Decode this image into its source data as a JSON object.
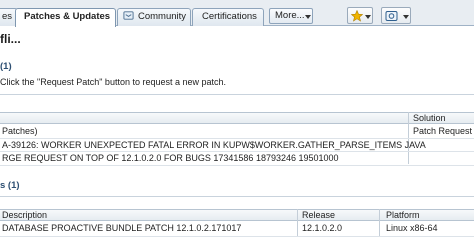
{
  "tabs": {
    "partial_prev_label": "es",
    "active_label": "Patches & Updates",
    "community_label": "Community",
    "certifications_label": "Certifications",
    "more_label": "More..."
  },
  "page": {
    "title": "fli..."
  },
  "requests_section": {
    "heading": "(1)",
    "instruction": "Click the \"Request Patch\" button to request a new patch.",
    "columns": [
      "",
      "Solution"
    ],
    "rows": [
      {
        "description": "Patches)",
        "solution": "Patch Request I..."
      },
      {
        "description": "A-39126: WORKER UNEXPECTED FATAL ERROR IN KUPW$WORKER.GATHER_PARSE_ITEMS JAVA",
        "solution": ""
      },
      {
        "description": "RGE REQUEST ON TOP OF 12.1.0.2.0 FOR BUGS 17341586 18793246 19501000",
        "solution": ""
      }
    ]
  },
  "patches_section": {
    "heading": "s (1)",
    "columns": [
      "Description",
      "Release",
      "Platform"
    ],
    "rows": [
      {
        "description": "DATABASE PROACTIVE BUNDLE PATCH 12.1.0.2.171017",
        "release": "12.1.0.2.0",
        "platform": "Linux x86-64"
      }
    ]
  },
  "icons": {
    "community": "community-icon",
    "favorites": "star-icon",
    "settings": "db-settings-icon"
  },
  "colors": {
    "tab_bar": "#e8edf2",
    "section_heading": "#2d4f72",
    "table_header": "#e6ecf1",
    "star": "#f0b400"
  }
}
